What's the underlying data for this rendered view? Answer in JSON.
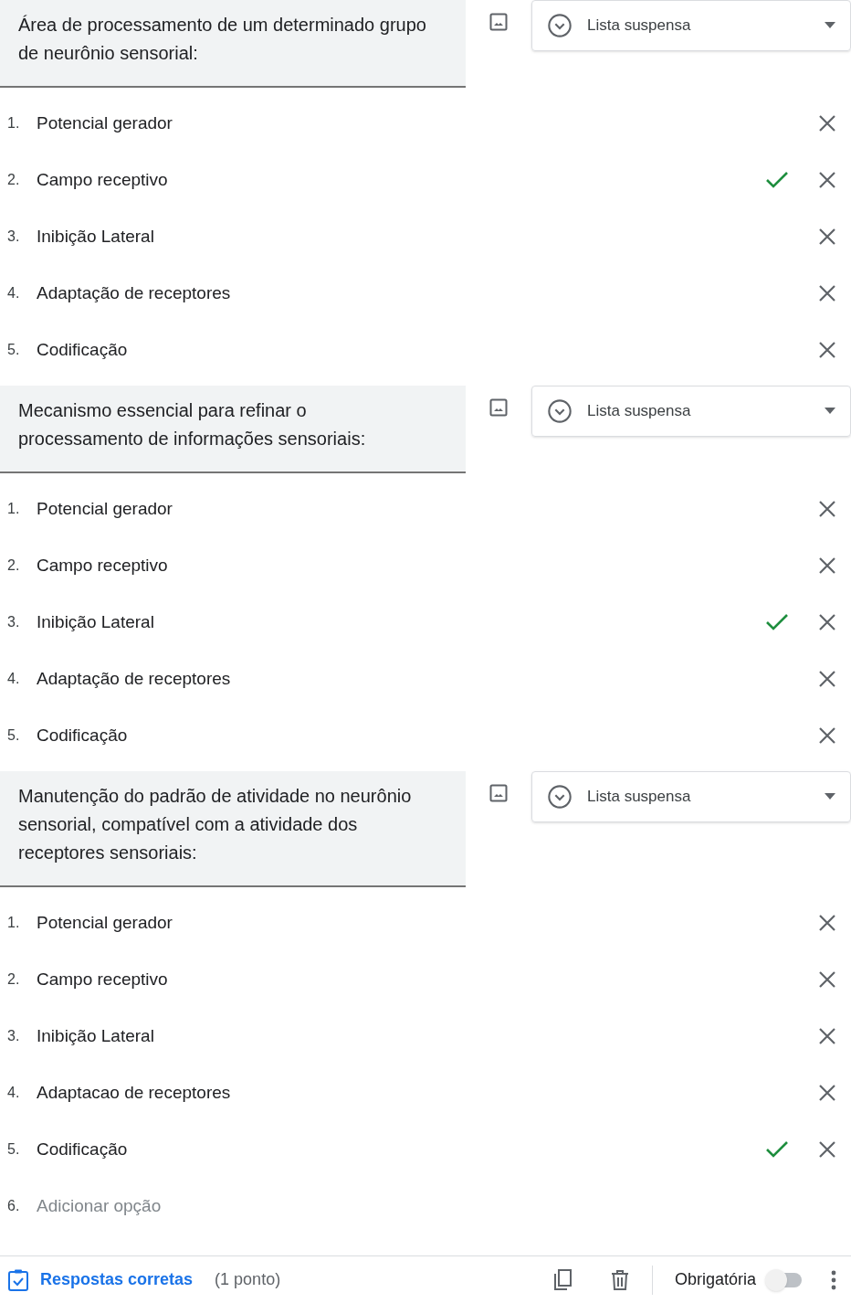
{
  "questions": [
    {
      "title": "Área de processamento de um determinado grupo de neurônio sensorial:",
      "type": "Lista suspensa",
      "options": [
        {
          "number": "1.",
          "text": "Potencial gerador",
          "correct": false
        },
        {
          "number": "2.",
          "text": "Campo receptivo",
          "correct": true
        },
        {
          "number": "3.",
          "text": "Inibição Lateral",
          "correct": false
        },
        {
          "number": "4.",
          "text": "Adaptação de receptores",
          "correct": false
        },
        {
          "number": "5.",
          "text": "Codificação",
          "correct": false
        }
      ]
    },
    {
      "title": "Mecanismo essencial para refinar o processamento de informações sensoriais:",
      "type": "Lista suspensa",
      "options": [
        {
          "number": "1.",
          "text": "Potencial gerador",
          "correct": false
        },
        {
          "number": "2.",
          "text": "Campo receptivo",
          "correct": false
        },
        {
          "number": "3.",
          "text": "Inibição Lateral",
          "correct": true
        },
        {
          "number": "4.",
          "text": "Adaptação de receptores",
          "correct": false
        },
        {
          "number": "5.",
          "text": "Codificação",
          "correct": false
        }
      ]
    },
    {
      "title": "Manutenção do padrão  de atividade no neurônio sensorial, compatível com a atividade dos receptores sensoriais:",
      "type": "Lista suspensa",
      "options": [
        {
          "number": "1.",
          "text": "Potencial gerador",
          "correct": false
        },
        {
          "number": "2.",
          "text": "Campo receptivo",
          "correct": false
        },
        {
          "number": "3.",
          "text": "Inibição Lateral",
          "correct": false
        },
        {
          "number": "4.",
          "text": "Adaptacao de receptores",
          "correct": false
        },
        {
          "number": "5.",
          "text": "Codificação",
          "correct": true
        }
      ],
      "add_option": {
        "number": "6.",
        "text": "Adicionar opção"
      }
    }
  ],
  "footer": {
    "answer_key": "Respostas corretas",
    "points": "(1 ponto)",
    "required_label": "Obrigatória",
    "required": false
  }
}
